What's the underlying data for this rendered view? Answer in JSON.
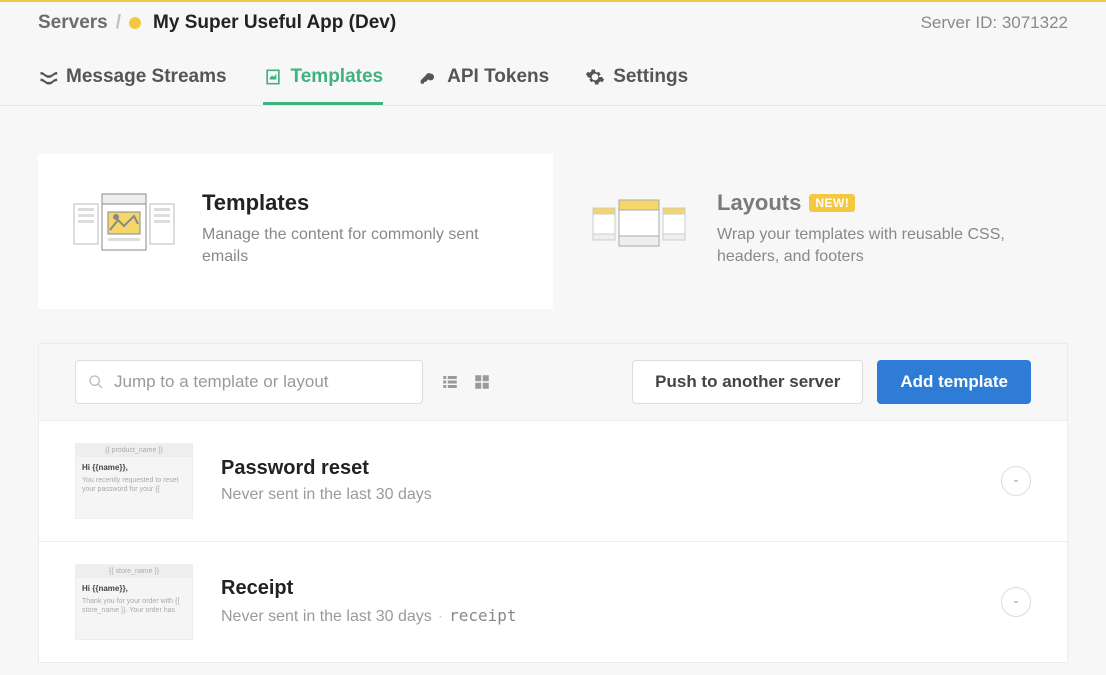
{
  "breadcrumb": {
    "servers": "Servers",
    "app_name": "My Super Useful App (Dev)"
  },
  "server_id_label": "Server ID: 3071322",
  "nav": {
    "streams": "Message Streams",
    "templates": "Templates",
    "api_tokens": "API Tokens",
    "settings": "Settings"
  },
  "subtabs": {
    "templates": {
      "title": "Templates",
      "desc": "Manage the content for commonly sent emails"
    },
    "layouts": {
      "title": "Layouts",
      "badge": "NEW!",
      "desc": "Wrap your templates with reusable CSS, headers, and footers"
    }
  },
  "search": {
    "placeholder": "Jump to a template or layout"
  },
  "actions": {
    "push": "Push to another server",
    "add": "Add template"
  },
  "templates": [
    {
      "thumb_header": "{{ product_name }}",
      "thumb_hi": "Hi {{name}},",
      "thumb_text": "You recently requested to reset your password for your {{",
      "title": "Password reset",
      "subtitle": "Never sent in the last 30 days",
      "alias": ""
    },
    {
      "thumb_header": "{{ store_name }}",
      "thumb_hi": "Hi {{name}},",
      "thumb_text": "Thank you for your order with {{ store_name }}. Your order has",
      "title": "Receipt",
      "subtitle": "Never sent in the last 30 days",
      "alias": "receipt"
    }
  ]
}
